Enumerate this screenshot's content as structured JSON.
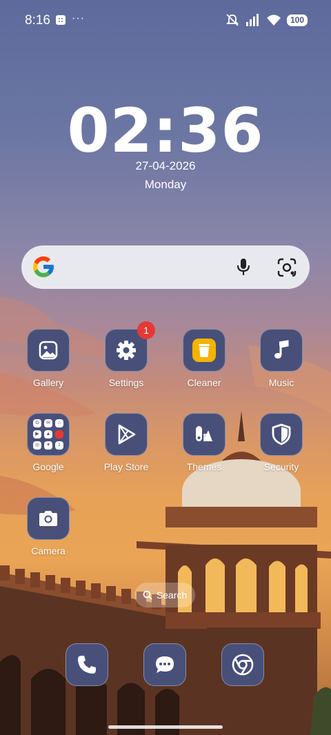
{
  "status_bar": {
    "time": "8:16",
    "more": "···",
    "battery": "100"
  },
  "clock": {
    "time": "02:36",
    "date": "27-04-2026",
    "weekday": "Monday"
  },
  "apps": [
    {
      "label": "Gallery",
      "icon": "gallery-icon"
    },
    {
      "label": "Settings",
      "icon": "gear-icon",
      "badge": "1"
    },
    {
      "label": "Cleaner",
      "icon": "trash-icon"
    },
    {
      "label": "Music",
      "icon": "music-note-icon"
    },
    {
      "label": "Google",
      "icon": "folder-icon"
    },
    {
      "label": "Play Store",
      "icon": "play-store-icon"
    },
    {
      "label": "Themes",
      "icon": "themes-icon"
    },
    {
      "label": "Security",
      "icon": "shield-icon"
    },
    {
      "label": "Camera",
      "icon": "camera-icon"
    }
  ],
  "home_search": {
    "label": "Search"
  },
  "dock": [
    {
      "icon": "phone-icon"
    },
    {
      "icon": "messages-icon"
    },
    {
      "icon": "chrome-icon"
    }
  ],
  "colors": {
    "icon_bg": "#48507a",
    "badge": "#e53935",
    "cleaner_accent": "#f5b400"
  }
}
